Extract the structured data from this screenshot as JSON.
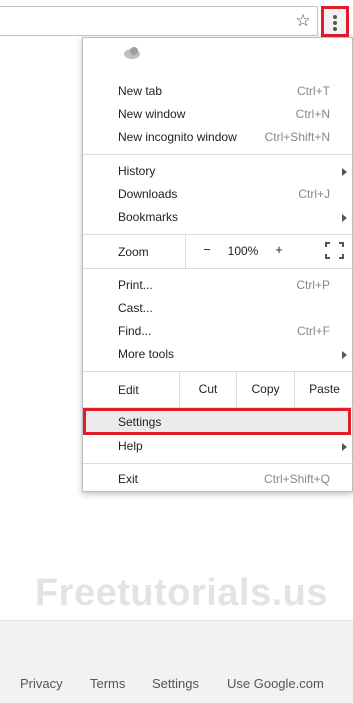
{
  "toolbar": {
    "bookmark_icon": "star-outline-icon",
    "menu_icon": "three-dots-vertical-icon"
  },
  "menu": {
    "profile_icon": "profile-avatar-icon",
    "items": [
      {
        "label": "New tab",
        "shortcut": "Ctrl+T"
      },
      {
        "label": "New window",
        "shortcut": "Ctrl+N"
      },
      {
        "label": "New incognito window",
        "shortcut": "Ctrl+Shift+N"
      },
      {
        "label": "History",
        "submenu": true
      },
      {
        "label": "Downloads",
        "shortcut": "Ctrl+J"
      },
      {
        "label": "Bookmarks",
        "submenu": true
      },
      {
        "label": "Print...",
        "shortcut": "Ctrl+P"
      },
      {
        "label": "Cast..."
      },
      {
        "label": "Find...",
        "shortcut": "Ctrl+F"
      },
      {
        "label": "More tools",
        "submenu": true
      },
      {
        "label": "Settings",
        "highlighted": true
      },
      {
        "label": "Help",
        "submenu": true
      },
      {
        "label": "Exit",
        "shortcut": "Ctrl+Shift+Q"
      }
    ],
    "zoom": {
      "label": "Zoom",
      "minus": "−",
      "level": "100%",
      "plus": "+",
      "fullscreen_icon": "fullscreen-icon"
    },
    "edit": {
      "label": "Edit",
      "cut": "Cut",
      "copy": "Copy",
      "paste": "Paste"
    }
  },
  "watermark": "Freetutorials.us",
  "footer": {
    "links": [
      "Privacy",
      "Terms",
      "Settings",
      "Use Google.com"
    ]
  },
  "colors": {
    "highlight_border": "#e11d2a",
    "menu_hover": "#ebebeb",
    "footer_bg": "#f2f2f2"
  }
}
